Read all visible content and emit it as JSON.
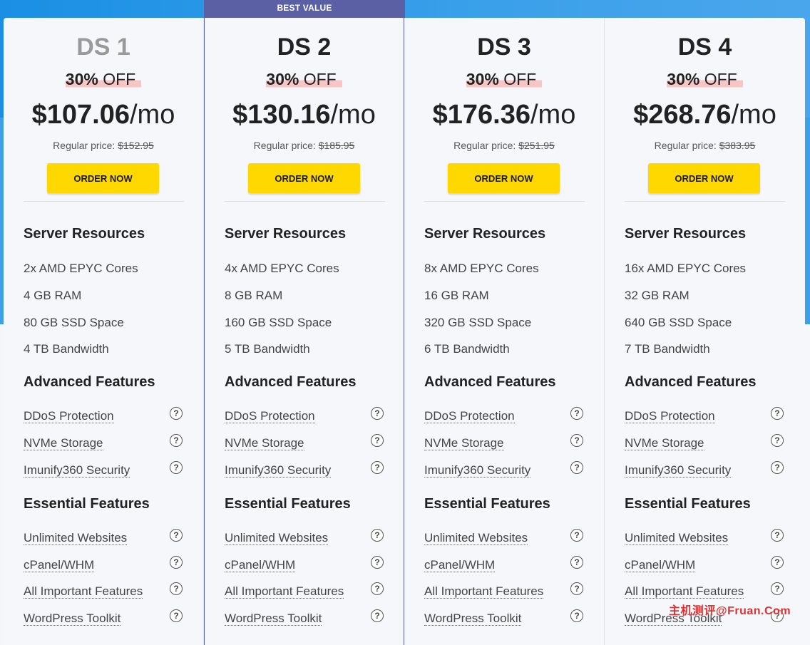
{
  "ribbon": "BEST VALUE",
  "headings": {
    "resources": "Server Resources",
    "advanced": "Advanced Features",
    "essential": "Essential Features"
  },
  "labels": {
    "off": "OFF",
    "mo": "/mo",
    "regular": "Regular price:",
    "order": "ORDER NOW",
    "help": "?"
  },
  "features": {
    "ddos": "DDoS Protection",
    "nvme": "NVMe Storage",
    "imunify": "Imunify360 Security",
    "unlimited": "Unlimited Websites",
    "cpanel": "cPanel/WHM",
    "important": "All Important Features",
    "wordpress": "WordPress Toolkit"
  },
  "plans": [
    {
      "name": "DS 1",
      "discount": "30%",
      "price": "$107.06",
      "regular": "$152.95",
      "cores": "2x AMD EPYC Cores",
      "ram": "4 GB RAM",
      "ssd": "80 GB SSD Space",
      "bandwidth": "4 TB Bandwidth"
    },
    {
      "name": "DS 2",
      "discount": "30%",
      "price": "$130.16",
      "regular": "$185.95",
      "cores": "4x AMD EPYC Cores",
      "ram": "8 GB RAM",
      "ssd": "160 GB SSD Space",
      "bandwidth": "5 TB Bandwidth"
    },
    {
      "name": "DS 3",
      "discount": "30%",
      "price": "$176.36",
      "regular": "$251.95",
      "cores": "8x AMD EPYC Cores",
      "ram": "16 GB RAM",
      "ssd": "320 GB SSD Space",
      "bandwidth": "6 TB Bandwidth"
    },
    {
      "name": "DS 4",
      "discount": "30%",
      "price": "$268.76",
      "regular": "$383.95",
      "cores": "16x AMD EPYC Cores",
      "ram": "32 GB RAM",
      "ssd": "640 GB SSD Space",
      "bandwidth": "7 TB Bandwidth"
    }
  ],
  "watermark": "主机测评@Fruan.Com",
  "colors": {
    "accent": "#ffd800",
    "ribbon": "#5b5fa4",
    "background": "#3d9fe8"
  }
}
